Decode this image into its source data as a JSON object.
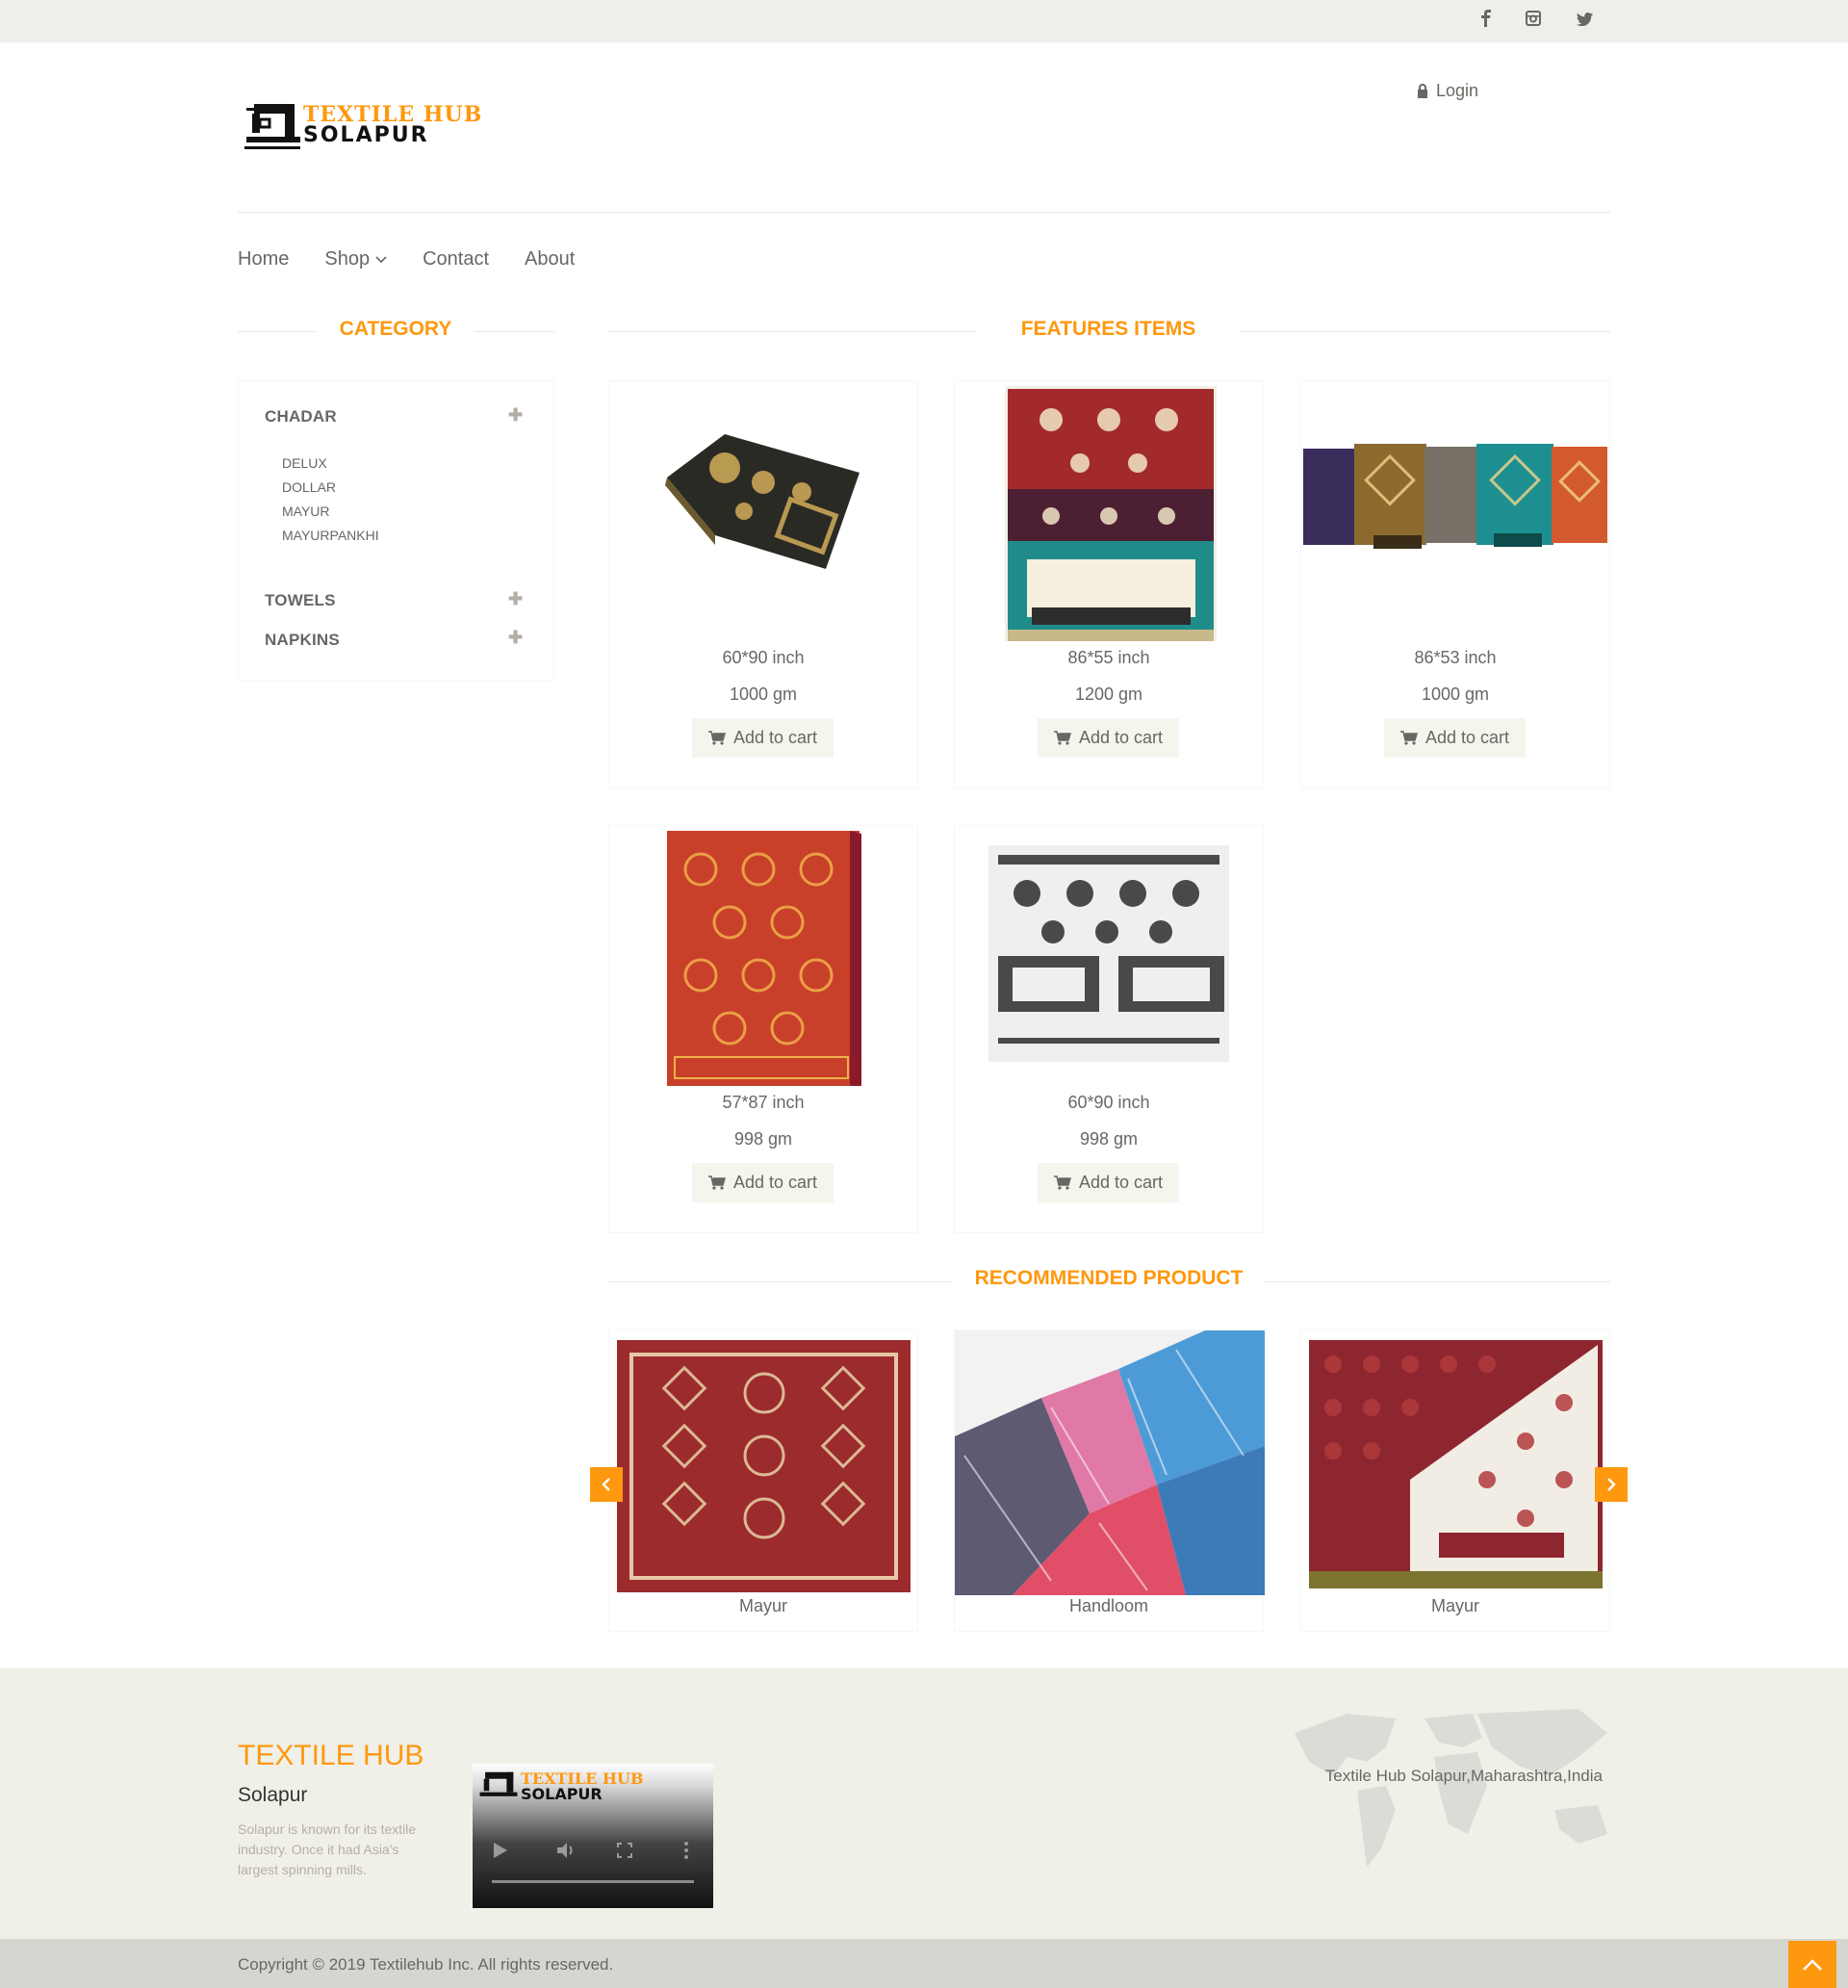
{
  "header": {
    "social": [
      {
        "name": "facebook-icon",
        "glyph": "f"
      },
      {
        "name": "instagram-icon",
        "glyph": "◙"
      },
      {
        "name": "twitter-icon",
        "glyph": "✓"
      }
    ],
    "logo": {
      "line1": "TEXTILE HUB",
      "line2": "SOLAPUR"
    },
    "login_label": "Login"
  },
  "nav": {
    "home": "Home",
    "shop": "Shop",
    "contact": "Contact",
    "about": "About"
  },
  "category": {
    "title": "CATEGORY",
    "groups": [
      {
        "label": "CHADAR",
        "subs": [
          "DELUX",
          "DOLLAR",
          "MAYUR",
          "MAYURPANKHI"
        ]
      },
      {
        "label": "TOWELS"
      },
      {
        "label": "NAPKINS"
      }
    ]
  },
  "features": {
    "title": "FEATURES ITEMS",
    "cart_label": "Add to cart",
    "items": [
      {
        "size": "60*90 inch",
        "weight": "1000 gm"
      },
      {
        "size": "86*55 inch",
        "weight": "1200 gm"
      },
      {
        "size": "86*53 inch",
        "weight": "1000 gm"
      },
      {
        "size": "57*87 inch",
        "weight": "998 gm"
      },
      {
        "size": "60*90 inch",
        "weight": "998 gm"
      }
    ]
  },
  "recommended": {
    "title": "RECOMMENDED PRODUCT",
    "items": [
      {
        "name": "Mayur"
      },
      {
        "name": "Handloom"
      },
      {
        "name": "Mayur"
      }
    ]
  },
  "footer": {
    "brand": "TEXTILE HUB",
    "city": "Solapur",
    "description": "Solapur is known for its textile industry. Once it had Asia's largest spinning mills.",
    "video_logo_line1": "TEXTILE HUB",
    "video_logo_line2": "SOLAPUR",
    "address": "Textile Hub Solapur,Maharashtra,India",
    "copyright": "Copyright © 2019 Textilehub Inc. All rights reserved."
  },
  "colors": {
    "accent": "#fe980f",
    "topbar": "#efeeea",
    "footer": "#f0f0e9"
  }
}
